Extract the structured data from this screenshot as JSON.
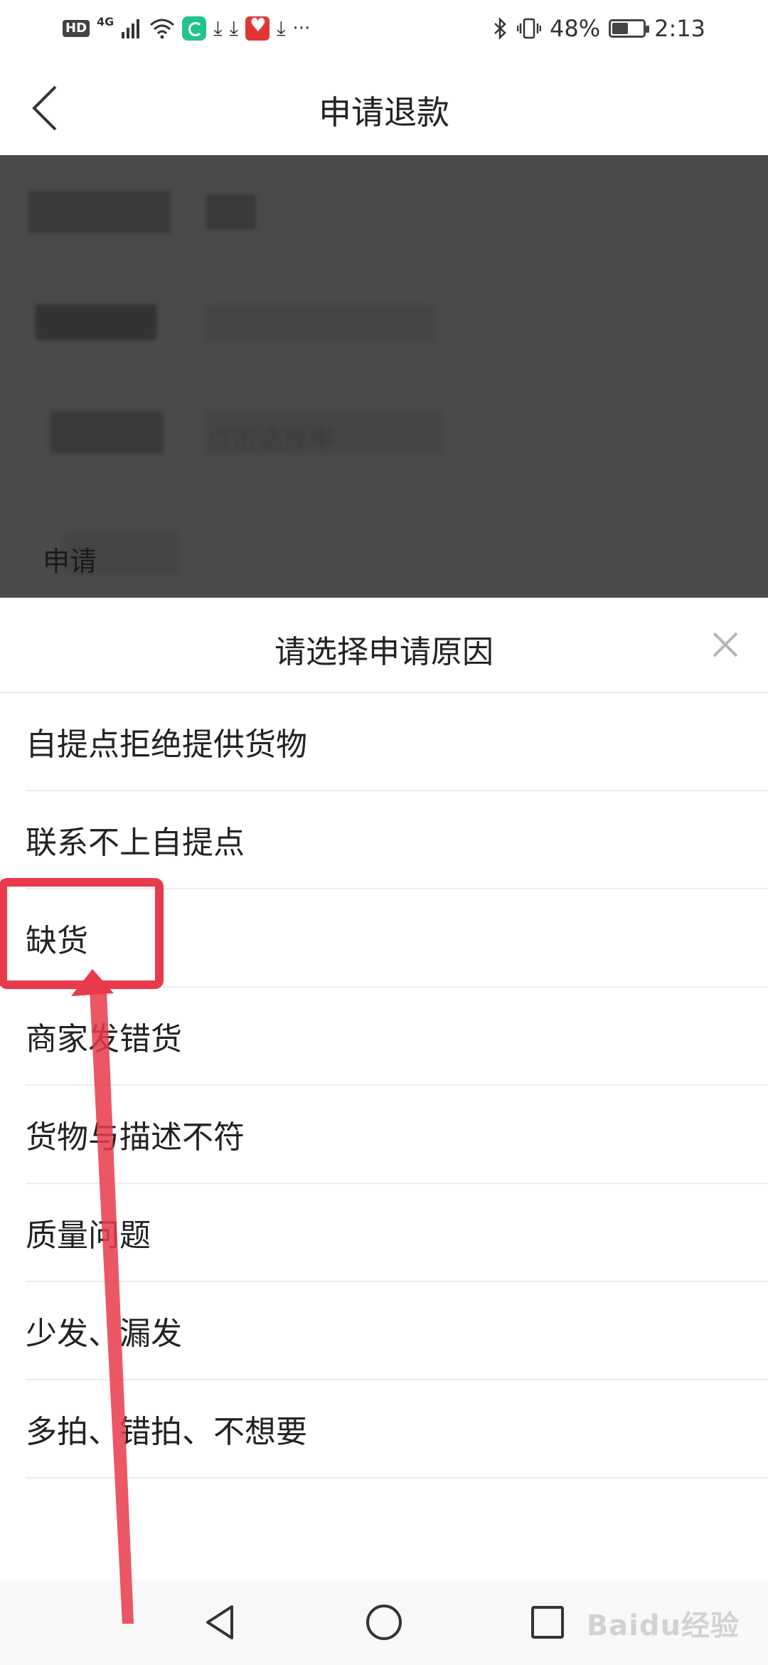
{
  "status_bar": {
    "hd": "HD",
    "network": "4G",
    "battery_percent": "48%",
    "time": "2:13",
    "more": "···",
    "icons": [
      "hd-icon",
      "signal-icon",
      "wifi-icon",
      "app-icon",
      "download-icon",
      "download-icon",
      "app-icon",
      "download-icon",
      "bluetooth-icon",
      "vibrate-icon",
      "battery-icon"
    ]
  },
  "header": {
    "title": "申请退款",
    "back_icon": "back-arrow-icon"
  },
  "background": {
    "visible_label": "申请",
    "hint_partial": "点击选择申"
  },
  "sheet": {
    "title": "请选择申请原因",
    "close_icon": "close-icon",
    "reasons": [
      "自提点拒绝提供货物",
      "联系不上自提点",
      "缺货",
      "商家发错货",
      "货物与描述不符",
      "质量问题",
      "少发、漏发",
      "多拍、错拍、不想要"
    ]
  },
  "nav_bar": {
    "icons": [
      "back-triangle-icon",
      "home-circle-icon",
      "recents-square-icon"
    ]
  },
  "annotation": {
    "color": "#e83a4a",
    "highlighted_item": "缺货"
  },
  "watermark": "Baidu经验"
}
